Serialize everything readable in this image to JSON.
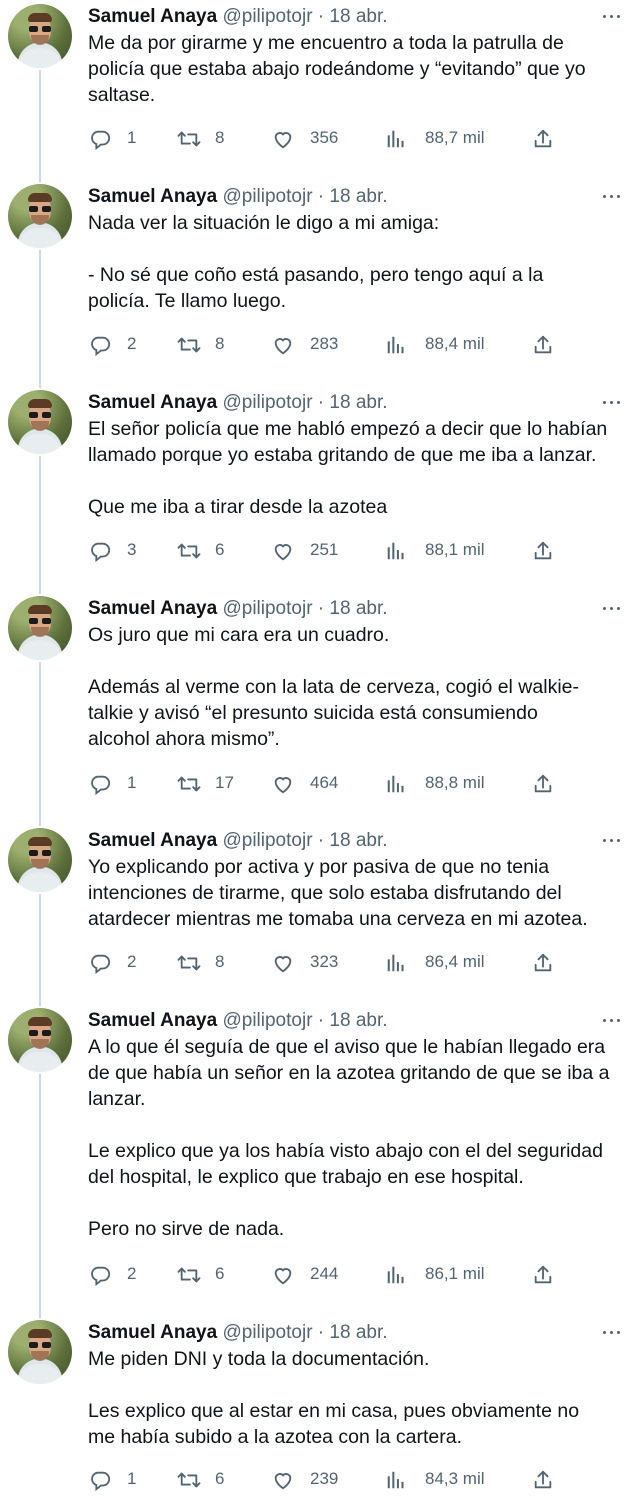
{
  "author": {
    "name": "Samuel Anaya",
    "handle": "@pilipotojr",
    "separator": "·"
  },
  "icons": {
    "more": "more-icon",
    "reply": "reply-icon",
    "retweet": "retweet-icon",
    "like": "heart-icon",
    "views": "views-icon",
    "share": "share-icon"
  },
  "colors": {
    "text": "#0f1419",
    "secondary": "#536471",
    "thread_line": "#cfd9de"
  },
  "tweets": [
    {
      "date": "18 abr.",
      "text": "Me da por girarme y me encuentro a toda la patrulla de\npolicía que estaba abajo rodeándome y “evitando” que yo\nsaltase.",
      "replies": "1",
      "retweets": "8",
      "likes": "356",
      "views": "88,7 mil"
    },
    {
      "date": "18 abr.",
      "text": "Nada ver la situación le digo a mi amiga:\n\n- No sé que coño está pasando, pero tengo aquí a la\npolicía. Te llamo luego.",
      "replies": "2",
      "retweets": "8",
      "likes": "283",
      "views": "88,4 mil"
    },
    {
      "date": "18 abr.",
      "text": "El señor policía que me habló empezó a decir que lo habían\nllamado porque yo estaba gritando de que me iba a lanzar.\n\nQue me iba a tirar desde la azotea",
      "replies": "3",
      "retweets": "6",
      "likes": "251",
      "views": "88,1 mil"
    },
    {
      "date": "18 abr.",
      "text": "Os juro que mi cara era un cuadro.\n\nAdemás al verme con la lata de cerveza, cogió el walkie-\ntalkie y avisó “el presunto suicida está consumiendo\nalcohol ahora mismo”.",
      "replies": "1",
      "retweets": "17",
      "likes": "464",
      "views": "88,8 mil"
    },
    {
      "date": "18 abr.",
      "text": "Yo explicando por activa y por pasiva de que no tenia\nintenciones de tirarme, que solo estaba disfrutando del\natardecer mientras me tomaba una cerveza en mi azotea.",
      "replies": "2",
      "retweets": "8",
      "likes": "323",
      "views": "86,4 mil"
    },
    {
      "date": "18 abr.",
      "text": "A lo que él seguía de que el aviso que le habían llegado era\nde que había un señor en la azotea gritando de que se iba a\nlanzar.\n\nLe explico que ya los había visto abajo con el del seguridad\ndel hospital, le explico que trabajo en ese hospital.\n\nPero no sirve de nada.",
      "replies": "2",
      "retweets": "6",
      "likes": "244",
      "views": "86,1 mil"
    },
    {
      "date": "18 abr.",
      "text": "Me piden DNI y toda la documentación.\n\nLes explico que al estar en mi casa, pues obviamente no\nme había subido a la azotea con la cartera.",
      "replies": "1",
      "retweets": "6",
      "likes": "239",
      "views": "84,3 mil"
    }
  ]
}
